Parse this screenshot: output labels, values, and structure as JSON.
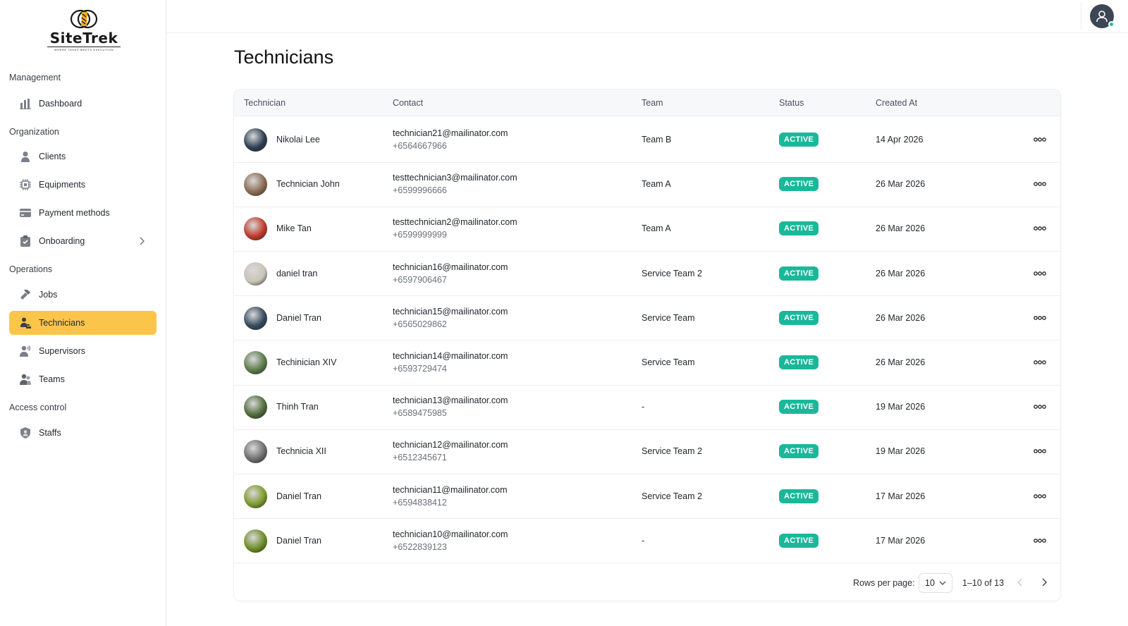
{
  "brand": {
    "name": "SiteTrek",
    "tagline": "WHERE TASKS MEETS EXECUTION"
  },
  "sidebar": {
    "sections": [
      {
        "label": "Management"
      },
      {
        "label": "Organization"
      },
      {
        "label": "Operations"
      },
      {
        "label": "Access control"
      }
    ],
    "items": [
      {
        "label": "Dashboard",
        "icon": "bar-chart-icon"
      },
      {
        "label": "Clients",
        "icon": "person-icon"
      },
      {
        "label": "Equipments",
        "icon": "chip-icon"
      },
      {
        "label": "Payment methods",
        "icon": "card-icon"
      },
      {
        "label": "Onboarding",
        "icon": "clipboard-icon"
      },
      {
        "label": "Jobs",
        "icon": "hammer-icon"
      },
      {
        "label": "Technicians",
        "icon": "technician-icon",
        "active": true
      },
      {
        "label": "Supervisors",
        "icon": "supervisor-icon"
      },
      {
        "label": "Teams",
        "icon": "team-icon"
      },
      {
        "label": "Staffs",
        "icon": "shield-person-icon"
      }
    ]
  },
  "page": {
    "title": "Technicians"
  },
  "table": {
    "columns": [
      "Technician",
      "Contact",
      "Team",
      "Status",
      "Created At"
    ],
    "rows": [
      {
        "name": "Nikolai Lee",
        "email": "technician21@mailinator.com",
        "phone": "+6564667966",
        "team": "Team B",
        "status": "ACTIVE",
        "created": "14 Apr 2026"
      },
      {
        "name": "Technician John",
        "email": "testtechnician3@mailinator.com",
        "phone": "+6599996666",
        "team": "Team A",
        "status": "ACTIVE",
        "created": "26 Mar 2026"
      },
      {
        "name": "Mike Tan",
        "email": "testtechnician2@mailinator.com",
        "phone": "+6599999999",
        "team": "Team A",
        "status": "ACTIVE",
        "created": "26 Mar 2026"
      },
      {
        "name": "daniel tran",
        "email": "technician16@mailinator.com",
        "phone": "+6597906467",
        "team": "Service Team 2",
        "status": "ACTIVE",
        "created": "26 Mar 2026"
      },
      {
        "name": "Daniel Tran",
        "email": "technician15@mailinator.com",
        "phone": "+6565029862",
        "team": "Service Team",
        "status": "ACTIVE",
        "created": "26 Mar 2026"
      },
      {
        "name": "Techinician XIV",
        "email": "technician14@mailinator.com",
        "phone": "+6593729474",
        "team": "Service Team",
        "status": "ACTIVE",
        "created": "26 Mar 2026"
      },
      {
        "name": "Thinh Tran",
        "email": "technician13@mailinator.com",
        "phone": "+6589475985",
        "team": "-",
        "status": "ACTIVE",
        "created": "19 Mar 2026"
      },
      {
        "name": "Technicia XII",
        "email": "technician12@mailinator.com",
        "phone": "+6512345671",
        "team": "Service Team 2",
        "status": "ACTIVE",
        "created": "19 Mar 2026"
      },
      {
        "name": "Daniel Tran",
        "email": "technician11@mailinator.com",
        "phone": "+6594838412",
        "team": "Service Team 2",
        "status": "ACTIVE",
        "created": "17 Mar 2026"
      },
      {
        "name": "Daniel Tran",
        "email": "technician10@mailinator.com",
        "phone": "+6522839123",
        "team": "-",
        "status": "ACTIVE",
        "created": "17 Mar 2026"
      }
    ]
  },
  "pagination": {
    "rows_per_page_label": "Rows per page:",
    "rows_per_page": "10",
    "range": "1–10 of 13"
  },
  "colors": {
    "accent": "#fbc54a",
    "status_active": "#19b89a",
    "online": "#19c39c"
  }
}
